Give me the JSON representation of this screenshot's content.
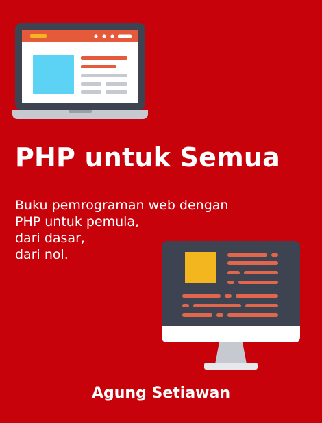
{
  "book": {
    "title": "PHP untuk Semua",
    "subtitle_lines": [
      "Buku pemrograman web dengan",
      "PHP untuk pemula,",
      "dari dasar,",
      "dari nol."
    ],
    "author": "Agung Setiawan"
  },
  "illustrations": {
    "laptop": {
      "icon": "laptop-icon"
    },
    "monitor": {
      "icon": "desktop-monitor-icon"
    }
  },
  "colors": {
    "background": "#c8020b",
    "text": "#ffffff",
    "device_frame": "#3d4350",
    "accent_orange": "#e55a3b",
    "code_salmon": "#e2664c",
    "block_blue": "#5cd3f5",
    "block_yellow": "#f3b61f"
  }
}
